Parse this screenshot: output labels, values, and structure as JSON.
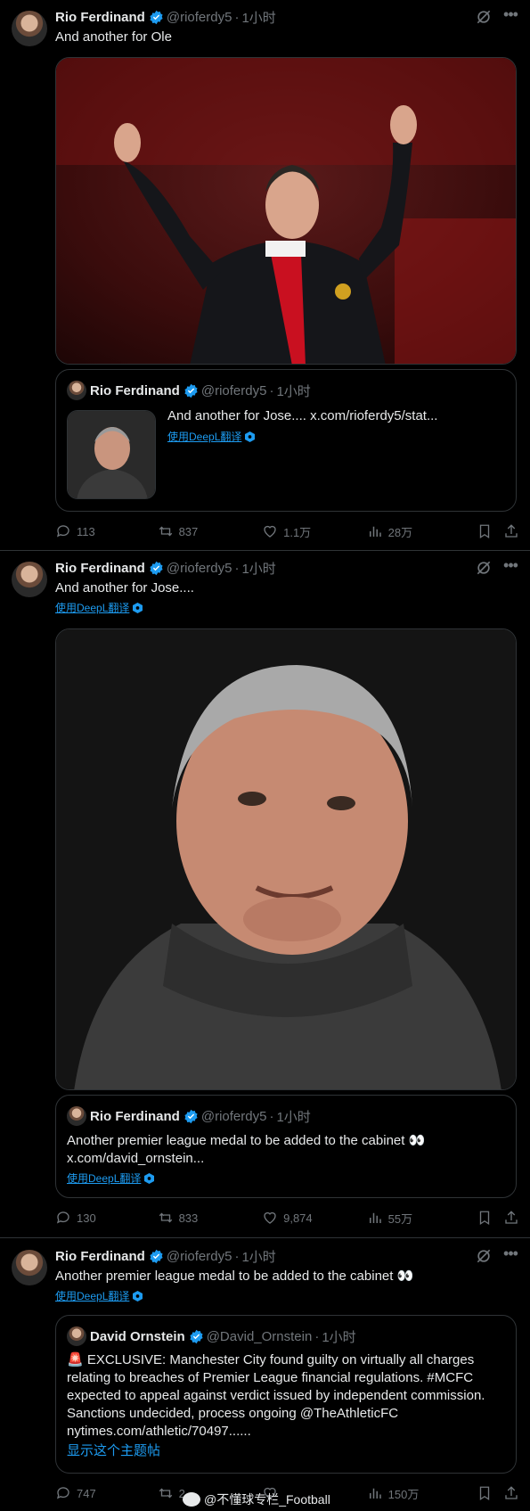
{
  "tweets": [
    {
      "author": "Rio Ferdinand",
      "handle": "@rioferdy5",
      "time": "1小时",
      "text": "And another for Ole",
      "quote": {
        "author": "Rio Ferdinand",
        "handle": "@rioferdy5",
        "time": "1小时",
        "text": "And another for Jose....  x.com/rioferdy5/stat...",
        "translate": "使用DeepL翻译"
      },
      "stats": {
        "replies": "113",
        "retweets": "837",
        "likes": "1.1万",
        "views": "28万"
      }
    },
    {
      "author": "Rio Ferdinand",
      "handle": "@rioferdy5",
      "time": "1小时",
      "text": "And another for Jose....",
      "translate": "使用DeepL翻译",
      "quote": {
        "author": "Rio Ferdinand",
        "handle": "@rioferdy5",
        "time": "1小时",
        "text": "Another premier league medal to be added to the cabinet 👀",
        "link": "x.com/david_ornstein...",
        "translate": "使用DeepL翻译"
      },
      "stats": {
        "replies": "130",
        "retweets": "833",
        "likes": "9,874",
        "views": "55万"
      }
    },
    {
      "author": "Rio Ferdinand",
      "handle": "@rioferdy5",
      "time": "1小时",
      "text": "Another premier league medal to be added to the cabinet 👀",
      "translate": "使用DeepL翻译",
      "quote": {
        "author": "David Ornstein",
        "handle": "@David_Ornstein",
        "time": "1小时",
        "text": "🚨 EXCLUSIVE: Manchester City found guilty on virtually all charges relating to breaches of Premier League financial regulations. #MCFC expected to appeal against verdict issued by independent commission. Sanctions undecided, process ongoing @TheAthleticFC nytimes.com/athletic/70497......",
        "show_thread": "显示这个主题帖"
      },
      "stats": {
        "replies": "747",
        "retweets": "2...",
        "likes": "",
        "views": "150万"
      }
    }
  ],
  "watermark": "@不懂球专栏_Football",
  "colors": {
    "accent": "#1d9bf0",
    "muted": "#71767b",
    "border": "#2f3336",
    "background": "#000000"
  }
}
